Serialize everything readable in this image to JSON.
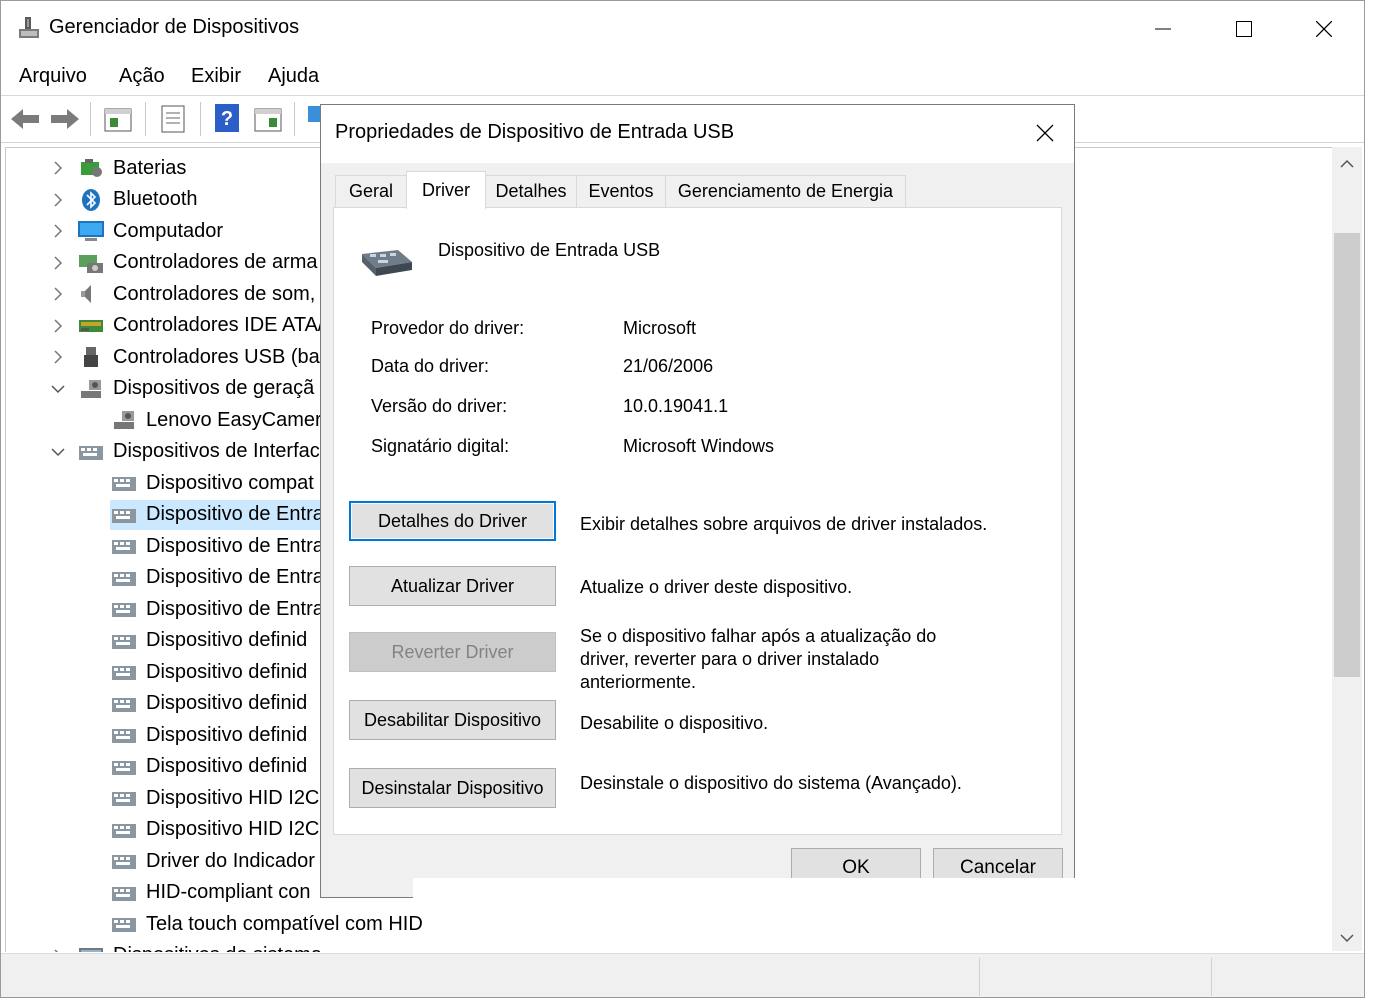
{
  "window": {
    "title": "Gerenciador de Dispositivos"
  },
  "menu": [
    "Arquivo",
    "Ação",
    "Exibir",
    "Ajuda"
  ],
  "tree": [
    {
      "label": "Baterias",
      "level": 0,
      "expanded": false,
      "icon": "battery-icon"
    },
    {
      "label": "Bluetooth",
      "level": 0,
      "expanded": false,
      "icon": "bluetooth-icon"
    },
    {
      "label": "Computador",
      "level": 0,
      "expanded": false,
      "icon": "computer-icon"
    },
    {
      "label": "Controladores de arma",
      "level": 0,
      "expanded": false,
      "icon": "storage-controller-icon"
    },
    {
      "label": "Controladores de som,",
      "level": 0,
      "expanded": false,
      "icon": "speaker-icon"
    },
    {
      "label": "Controladores IDE ATA/",
      "level": 0,
      "expanded": false,
      "icon": "ide-controller-icon"
    },
    {
      "label": "Controladores USB (ba",
      "level": 0,
      "expanded": false,
      "icon": "usb-icon"
    },
    {
      "label": "Dispositivos de geraçã",
      "level": 0,
      "expanded": true,
      "icon": "camera-icon"
    },
    {
      "label": "Lenovo EasyCamera",
      "level": 1,
      "icon": "camera-icon"
    },
    {
      "label": "Dispositivos de Interfac",
      "level": 0,
      "expanded": true,
      "icon": "hid-icon"
    },
    {
      "label": "Dispositivo compat",
      "level": 1,
      "icon": "hid-icon"
    },
    {
      "label": "Dispositivo de Entra",
      "level": 1,
      "icon": "hid-icon",
      "selected": true
    },
    {
      "label": "Dispositivo de Entra",
      "level": 1,
      "icon": "hid-icon"
    },
    {
      "label": "Dispositivo de Entra",
      "level": 1,
      "icon": "hid-icon"
    },
    {
      "label": "Dispositivo de Entra",
      "level": 1,
      "icon": "hid-icon"
    },
    {
      "label": "Dispositivo definid",
      "level": 1,
      "icon": "hid-icon"
    },
    {
      "label": "Dispositivo definid",
      "level": 1,
      "icon": "hid-icon"
    },
    {
      "label": "Dispositivo definid",
      "level": 1,
      "icon": "hid-icon"
    },
    {
      "label": "Dispositivo definid",
      "level": 1,
      "icon": "hid-icon"
    },
    {
      "label": "Dispositivo definid",
      "level": 1,
      "icon": "hid-icon"
    },
    {
      "label": "Dispositivo HID I2C",
      "level": 1,
      "icon": "hid-icon"
    },
    {
      "label": "Dispositivo HID I2C",
      "level": 1,
      "icon": "hid-icon"
    },
    {
      "label": "Driver do Indicador",
      "level": 1,
      "icon": "hid-icon"
    },
    {
      "label": "HID-compliant con",
      "level": 1,
      "icon": "hid-icon"
    },
    {
      "label": "Tela touch compatível com HID",
      "level": 1,
      "icon": "hid-icon"
    },
    {
      "label": "Dispositivos de sistema",
      "level": 0,
      "expanded": false,
      "icon": "system-devices-icon"
    }
  ],
  "dialog": {
    "title": "Propriedades de Dispositivo de Entrada USB",
    "tabs": [
      "Geral",
      "Driver",
      "Detalhes",
      "Eventos",
      "Gerenciamento de Energia"
    ],
    "active_tab": "Driver",
    "device_name": "Dispositivo de Entrada USB",
    "fields": [
      {
        "label": "Provedor do driver:",
        "value": "Microsoft"
      },
      {
        "label": "Data do driver:",
        "value": "21/06/2006"
      },
      {
        "label": "Versão do driver:",
        "value": "10.0.19041.1"
      },
      {
        "label": "Signatário digital:",
        "value": "Microsoft Windows"
      }
    ],
    "actions": [
      {
        "label": "Detalhes do Driver",
        "desc": "Exibir detalhes sobre arquivos de driver instalados.",
        "state": "focused"
      },
      {
        "label": "Atualizar Driver",
        "desc": "Atualize o driver deste dispositivo.",
        "state": "normal"
      },
      {
        "label": "Reverter Driver",
        "desc": "Se o dispositivo falhar após a atualização do driver, reverter para o driver instalado anteriormente.",
        "state": "disabled"
      },
      {
        "label": "Desabilitar Dispositivo",
        "desc": "Desabilite o dispositivo.",
        "state": "normal"
      },
      {
        "label": "Desinstalar Dispositivo",
        "desc": "Desinstale o dispositivo do sistema (Avançado).",
        "state": "normal"
      }
    ],
    "ok_label": "OK",
    "cancel_label": "Cancelar"
  },
  "colors": {
    "selection": "#cce8ff",
    "focus": "#0078d7",
    "accent_blue": "#1e73be"
  }
}
